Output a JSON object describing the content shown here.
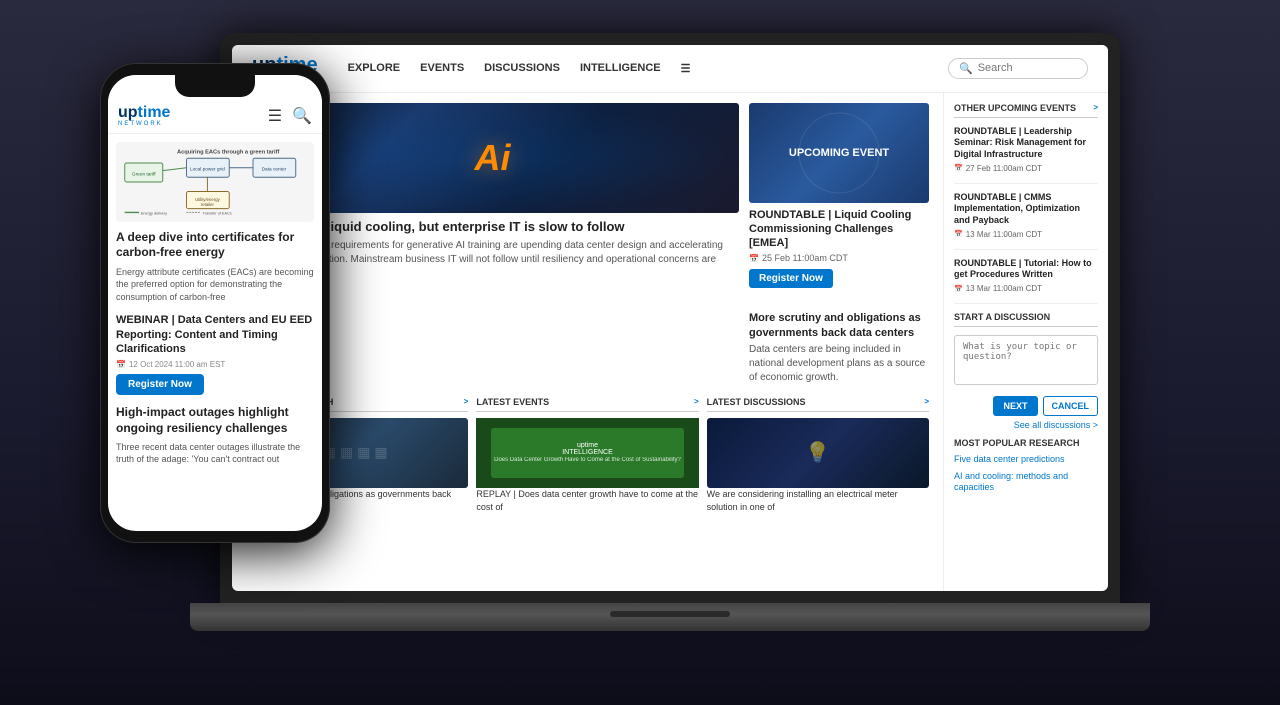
{
  "site": {
    "logo": {
      "uptime": "uptime",
      "uptime_accent": "time",
      "network": "NETWORK"
    },
    "nav": {
      "explore": "EXPLORE",
      "events": "EVENTS",
      "discussions": "DISCUSSIONS",
      "intelligence": "INTELLIGENCE",
      "search_placeholder": "Search"
    },
    "featured": {
      "article1": {
        "title": "AI embraces liquid cooling, but enterprise IT is slow to follow",
        "description": "Power and cooling requirements for generative AI training are upending data center design and accelerating liquid cooling adoption. Mainstream business IT will not follow until resiliency and operational concerns are addressed.",
        "image_alt": "AI chip image"
      },
      "event1": {
        "label": "UPCOMING EVENT",
        "title": "ROUNDTABLE | Liquid Cooling Commissioning Challenges [EMEA]",
        "date": "25 Feb  11:00am CDT",
        "register_btn": "Register Now",
        "description": ""
      },
      "event_desc": "More scrutiny and obligations as governments back data centers",
      "event_body": "Data centers are being included in national development plans as a source of economic growth."
    },
    "latest_research": {
      "header": "LATEST RESEARCH",
      "link": ">",
      "item": "More scrutiny and obligations as governments back data centers"
    },
    "latest_events": {
      "header": "LATEST EVENTS",
      "link": ">",
      "item": "REPLAY | Does data center growth have to come at the cost of"
    },
    "latest_discussions": {
      "header": "LATEST DISCUSSIONS",
      "link": ">",
      "item": "We are considering installing an electrical meter solution in one of"
    },
    "sidebar": {
      "upcoming_events_title": "OTHER UPCOMING EVENTS",
      "upcoming_link": ">",
      "events": [
        {
          "title": "ROUNDTABLE | Leadership Seminar: Risk Management for Digital Infrastructure",
          "date": "27 Feb  11:00am CDT"
        },
        {
          "title": "ROUNDTABLE | CMMS Implementation, Optimization and Payback",
          "date": "13 Mar  11:00am CDT"
        },
        {
          "title": "ROUNDTABLE | Tutorial: How to get Procedures Written",
          "date": "13 Mar  11:00am CDT"
        }
      ],
      "start_discussion_title": "START A DISCUSSION",
      "discussion_placeholder": "What is your topic or question?",
      "btn_next": "NEXT",
      "btn_cancel": "CANCEL",
      "see_all": "See all discussions >",
      "popular_research_title": "MOST POPULAR RESEARCH",
      "popular_items": [
        "Five data center predictions",
        "AI and cooling: methods and capacities"
      ]
    }
  },
  "phone": {
    "logo": {
      "up": "up",
      "time": "time",
      "network": "NETWORK"
    },
    "article1": {
      "diagram_label": "Acquiring EACs through a green tariff",
      "title": "A deep dive into certificates for carbon-free energy",
      "description": "Energy attribute certificates (EACs) are becoming the preferred option for demonstrating the consumption of carbon-free"
    },
    "article2": {
      "title": "WEBINAR | Data Centers and EU EED Reporting: Content and Timing Clarifications",
      "date": "12 Oct 2024 11:00 am EST",
      "register_btn": "Register Now"
    },
    "article3": {
      "title": "High-impact outages highlight ongoing resiliency challenges",
      "description": "Three recent data center outages illustrate the truth of the adage: 'You can't contract out"
    }
  }
}
